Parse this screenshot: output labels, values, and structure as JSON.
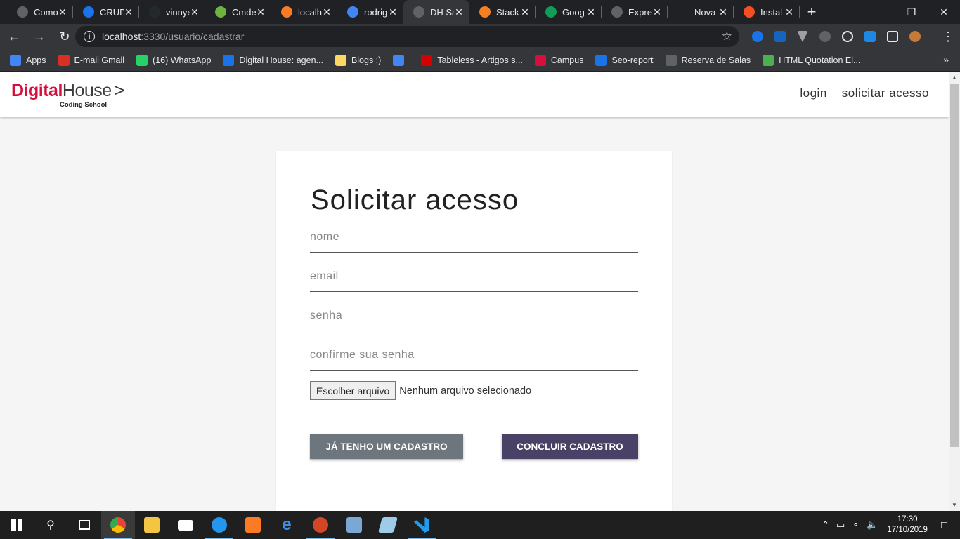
{
  "browser": {
    "tabs": [
      {
        "label": "Como",
        "color": "#5f6368",
        "active": false
      },
      {
        "label": "CRUD",
        "color": "#1a73e8",
        "active": false
      },
      {
        "label": "vinnye",
        "color": "#24292e",
        "active": false
      },
      {
        "label": "Cmde",
        "color": "#6db33f",
        "active": false
      },
      {
        "label": "localh",
        "color": "#fb7a24",
        "active": false
      },
      {
        "label": "rodrig",
        "color": "#4285f4",
        "active": false
      },
      {
        "label": "DH Sa",
        "color": "#5f6368",
        "active": true
      },
      {
        "label": "Stack",
        "color": "#f48024",
        "active": false
      },
      {
        "label": "Goog",
        "color": "#0f9d58",
        "active": false
      },
      {
        "label": "Expre",
        "color": "#5f6368",
        "active": false
      },
      {
        "label": "Nova guia",
        "color": "#202124",
        "active": false
      },
      {
        "label": "Instal",
        "color": "#f25022",
        "active": false
      }
    ],
    "address": {
      "host": "localhost",
      "path": ":3330/usuario/cadastrar"
    },
    "bookmarks": [
      {
        "label": "Apps",
        "color": "#4285f4"
      },
      {
        "label": "E-mail Gmail",
        "color": "#d93025"
      },
      {
        "label": "(16) WhatsApp",
        "color": "#25d366"
      },
      {
        "label": "Digital House: agen...",
        "color": "#1a73e8"
      },
      {
        "label": "Blogs :)",
        "color": "#fdd663"
      },
      {
        "label": "",
        "color": "#4285f4"
      },
      {
        "label": "Tableless - Artigos s...",
        "color": "#d50000"
      },
      {
        "label": "Campus",
        "color": "#d4103e"
      },
      {
        "label": "Seo-report",
        "color": "#1a73e8"
      },
      {
        "label": "Reserva de Salas",
        "color": "#5f6368"
      },
      {
        "label": "HTML Quotation El...",
        "color": "#4caf50"
      }
    ]
  },
  "site": {
    "logo_digital": "Digital",
    "logo_house": "House",
    "logo_arrow": ">",
    "logo_sub": "Coding School",
    "nav": {
      "login": "login",
      "signup": "solicitar acesso"
    }
  },
  "form": {
    "title": "Solicitar acesso",
    "fields": {
      "nome": "nome",
      "email": "email",
      "senha": "senha",
      "confirm": "confirme sua senha"
    },
    "file_button": "Escolher arquivo",
    "file_status": "Nenhum arquivo selecionado",
    "btn_login": "JÁ TENHO UM CADASTRO",
    "btn_submit": "CONCLUIR CADASTRO"
  },
  "taskbar": {
    "time": "17:30",
    "date": "17/10/2019"
  },
  "colors": {
    "accent": "#4a4266",
    "secondary": "#6e767d",
    "brand": "#d4103e"
  }
}
